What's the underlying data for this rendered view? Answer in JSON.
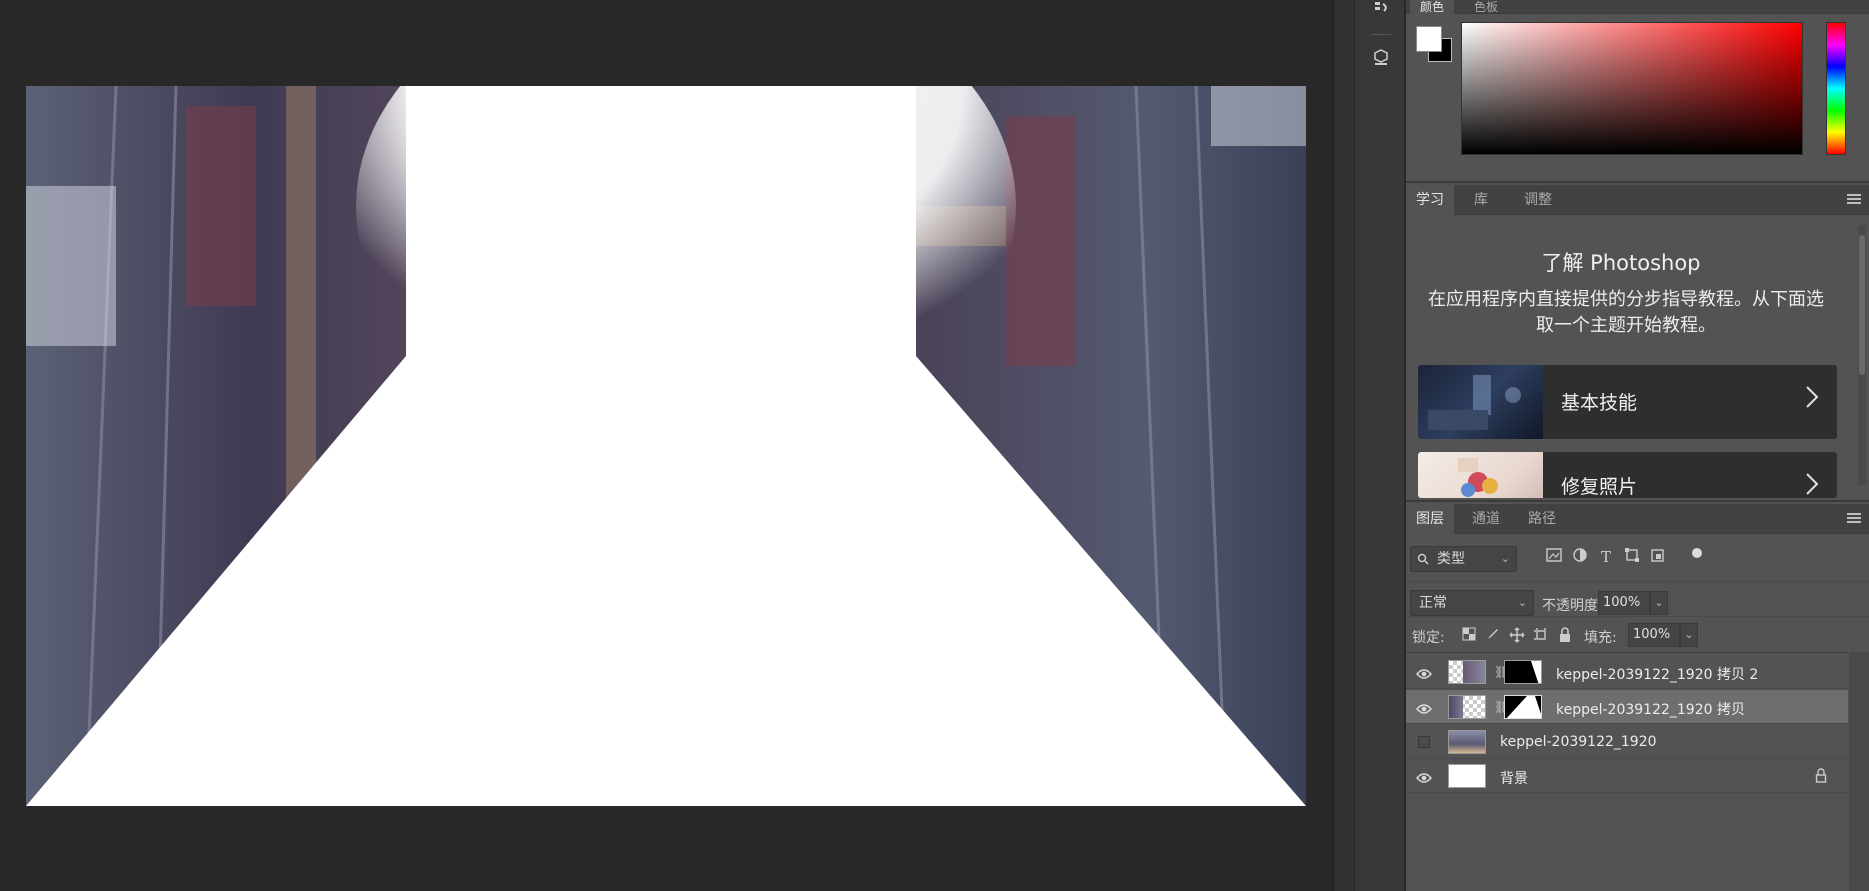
{
  "color_panel": {
    "tabs": [
      "颜色",
      "色板"
    ],
    "foreground_color": "#ffffff",
    "background_color": "#000000"
  },
  "learn_panel": {
    "tabs": [
      "学习",
      "库",
      "调整"
    ],
    "active_tab": "学习",
    "title": "了解 Photoshop",
    "description": "在应用程序内直接提供的分步指导教程。从下面选取一个主题开始教程。",
    "cards": [
      {
        "label": "基本技能",
        "icon": "chevron-right-icon"
      },
      {
        "label": "修复照片",
        "icon": "chevron-right-icon"
      }
    ]
  },
  "layers_panel": {
    "tabs": [
      "图层",
      "通道",
      "路径"
    ],
    "active_tab": "图层",
    "filter_kind": "类型",
    "blend_mode": "正常",
    "opacity_label": "不透明度:",
    "opacity_value": "100%",
    "lock_label": "锁定:",
    "fill_label": "填充:",
    "fill_value": "100%",
    "layers": [
      {
        "name": "keppel-2039122_1920 拷贝 2",
        "visible": true,
        "selected": false,
        "has_mask": true
      },
      {
        "name": "keppel-2039122_1920 拷贝",
        "visible": true,
        "selected": true,
        "has_mask": true
      },
      {
        "name": "keppel-2039122_1920",
        "visible": false,
        "selected": false,
        "has_mask": false
      },
      {
        "name": "背景",
        "visible": true,
        "selected": false,
        "locked": true
      }
    ]
  },
  "colors": {
    "workspace_bg": "#282828",
    "panel_bg": "#535353",
    "selected_layer": "#6e6e6e"
  }
}
